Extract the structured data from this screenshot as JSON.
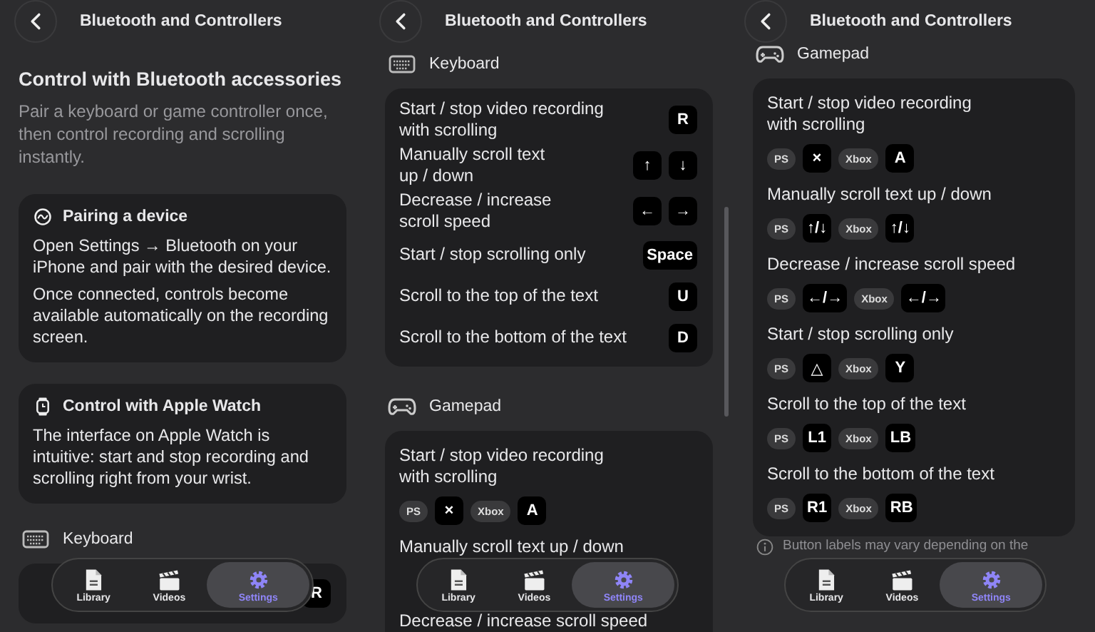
{
  "screens": [
    {
      "header": {
        "title": "Bluetooth and Controllers"
      },
      "sections": [
        {
          "kind": "intro",
          "title": "Control with Bluetooth accessories",
          "text": "Pair a keyboard or game controller once, then control recording and scrolling instantly."
        },
        {
          "kind": "pairing_card",
          "title": "Pairing a device",
          "paragraphs": [
            "Open Settings → Bluetooth on your iPhone and pair with the desired device.",
            "Once connected, controls become available automatically on the recording screen."
          ]
        },
        {
          "kind": "watch_card",
          "title": "Control with Apple Watch",
          "paragraphs": [
            "The interface on Apple Watch is intuitive: start and stop recording and scrolling right from your wrist."
          ]
        },
        {
          "kind": "keyboard_heading",
          "title": "Keyboard"
        },
        {
          "kind": "key_list",
          "rows": [
            {
              "keys": [
                "R"
              ]
            }
          ]
        }
      ],
      "tabs": [
        {
          "label": "Library",
          "selected": false
        },
        {
          "label": "Videos",
          "selected": false
        },
        {
          "label": "Settings",
          "selected": true
        }
      ]
    },
    {
      "header": {
        "title": "Bluetooth and Controllers"
      },
      "sections": [
        {
          "kind": "keyboard_heading",
          "title": "Keyboard"
        },
        {
          "kind": "key_list",
          "rows": [
            {
              "label": "Start / stop video recording\nwith scrolling",
              "keys": [
                "R"
              ]
            },
            {
              "label": "Manually scroll text\nup / down",
              "keys": [
                "↑",
                "↓"
              ]
            },
            {
              "label": "Decrease / increase\nscroll speed",
              "keys": [
                "←",
                "→"
              ]
            },
            {
              "label": "Start / stop scrolling only",
              "keys": [
                "Space"
              ]
            },
            {
              "label": "Scroll to the top of the text",
              "keys": [
                "U"
              ]
            },
            {
              "label": "Scroll to the bottom of the text",
              "keys": [
                "D"
              ]
            }
          ]
        },
        {
          "kind": "gamepad_heading",
          "title": "Gamepad"
        },
        {
          "kind": "pad_list",
          "rows": [
            {
              "label": "Start / stop video recording\nwith scrolling",
              "ps": "PS",
              "ps_key": "×",
              "xbox": "Xbox",
              "xbox_key": "A"
            },
            {
              "label": "Manually scroll text up / down"
            },
            {
              "label": "Decrease / increase scroll speed"
            }
          ]
        }
      ],
      "tabs": [
        {
          "label": "Library",
          "selected": false
        },
        {
          "label": "Videos",
          "selected": false
        },
        {
          "label": "Settings",
          "selected": true
        }
      ]
    },
    {
      "header": {
        "title": "Bluetooth and Controllers"
      },
      "sections": [
        {
          "kind": "gamepad_heading",
          "title": "Gamepad"
        },
        {
          "kind": "pad_list",
          "rows": [
            {
              "label": "Start / stop video recording\nwith scrolling",
              "ps": "PS",
              "ps_key": "×",
              "xbox": "Xbox",
              "xbox_key": "A"
            },
            {
              "label": "Manually scroll text up / down",
              "ps": "PS",
              "ps_key": "↑/↓",
              "xbox": "Xbox",
              "xbox_key": "↑/↓"
            },
            {
              "label": "Decrease / increase scroll speed",
              "ps": "PS",
              "ps_key": "←/→",
              "xbox": "Xbox",
              "xbox_key": "←/→"
            },
            {
              "label": "Start / stop scrolling only",
              "ps": "PS",
              "ps_key": "△",
              "xbox": "Xbox",
              "xbox_key": "Y"
            },
            {
              "label": "Scroll to the top of the text",
              "ps": "PS",
              "ps_key": "L1",
              "xbox": "Xbox",
              "xbox_key": "LB"
            },
            {
              "label": "Scroll to the bottom of the text",
              "ps": "PS",
              "ps_key": "R1",
              "xbox": "Xbox",
              "xbox_key": "RB"
            }
          ]
        },
        {
          "kind": "note",
          "text": "Button labels may vary depending on the"
        }
      ],
      "tabs": [
        {
          "label": "Library",
          "selected": false
        },
        {
          "label": "Videos",
          "selected": false
        },
        {
          "label": "Settings",
          "selected": true
        }
      ]
    }
  ]
}
